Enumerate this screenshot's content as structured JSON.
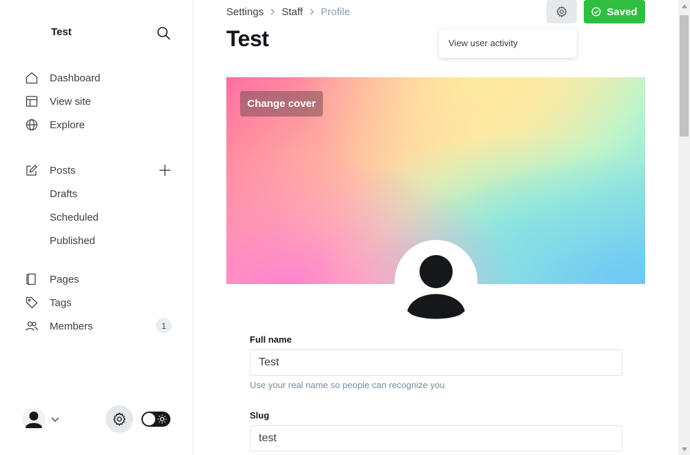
{
  "sidebar": {
    "site_title": "Test",
    "nav": [
      {
        "label": "Dashboard",
        "icon": "home-icon"
      },
      {
        "label": "View site",
        "icon": "layout-icon"
      },
      {
        "label": "Explore",
        "icon": "globe-icon"
      }
    ],
    "posts": {
      "label": "Posts",
      "sub": [
        "Drafts",
        "Scheduled",
        "Published"
      ]
    },
    "nav2": [
      {
        "label": "Pages",
        "icon": "page-icon"
      },
      {
        "label": "Tags",
        "icon": "tag-icon"
      },
      {
        "label": "Members",
        "icon": "members-icon",
        "count": "1"
      }
    ]
  },
  "header": {
    "breadcrumb": [
      "Settings",
      "Staff",
      "Profile"
    ],
    "title": "Test",
    "saved_label": "Saved",
    "dropdown_item": "View user activity"
  },
  "cover": {
    "change_cover_label": "Change cover"
  },
  "form": {
    "full_name": {
      "label": "Full name",
      "value": "Test",
      "hint": "Use your real name so people can recognize you"
    },
    "slug": {
      "label": "Slug",
      "value": "test"
    }
  },
  "colors": {
    "accent_green": "#2fbe3f",
    "text_primary": "#15171a",
    "text_muted": "#8e9cac"
  }
}
